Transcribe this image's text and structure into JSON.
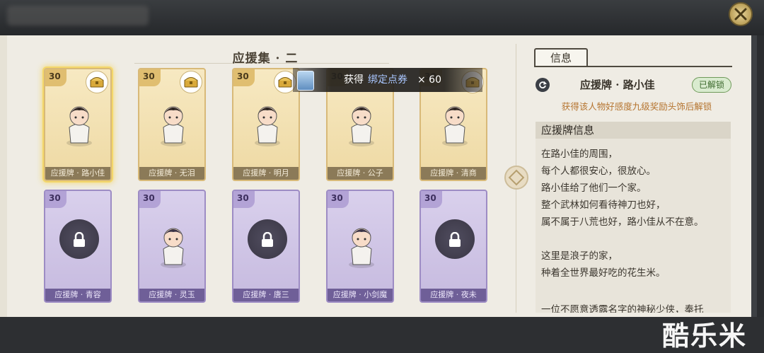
{
  "collection": {
    "title": "应援集 · 二"
  },
  "cards": [
    {
      "level": "30",
      "name": "应援牌 · 路小佳",
      "theme": "gold",
      "locked": false,
      "selected": true,
      "chest": true
    },
    {
      "level": "30",
      "name": "应援牌 · 无泪",
      "theme": "gold",
      "locked": false,
      "selected": false,
      "chest": true
    },
    {
      "level": "30",
      "name": "应援牌 · 明月",
      "theme": "gold",
      "locked": false,
      "selected": false,
      "chest": true
    },
    {
      "level": "30",
      "name": "应援牌 · 公子",
      "theme": "gold",
      "locked": false,
      "selected": false,
      "chest": false
    },
    {
      "level": "30",
      "name": "应援牌 · 清商",
      "theme": "gold",
      "locked": false,
      "selected": false,
      "chest": true
    },
    {
      "level": "30",
      "name": "应援牌 · 青容",
      "theme": "purple",
      "locked": true,
      "selected": false,
      "chest": false
    },
    {
      "level": "30",
      "name": "应援牌 · 灵玉",
      "theme": "purple",
      "locked": false,
      "selected": false,
      "chest": false
    },
    {
      "level": "30",
      "name": "应援牌 · 唐三",
      "theme": "purple",
      "locked": true,
      "selected": false,
      "chest": false
    },
    {
      "level": "30",
      "name": "应援牌 · 小剑魔",
      "theme": "purple",
      "locked": false,
      "selected": false,
      "chest": false
    },
    {
      "level": "30",
      "name": "应援牌 · 夜未",
      "theme": "purple",
      "locked": true,
      "selected": false,
      "chest": false
    }
  ],
  "toast": {
    "prefix": "获得",
    "item": "绑定点券",
    "count": "× 60"
  },
  "info_panel": {
    "tab_label": "信息",
    "title": "应援牌 · 路小佳",
    "status": "已解锁",
    "unlock_note": "获得该人物好感度九级奖励头饰后解锁",
    "section_header": "应援牌信息",
    "lines": [
      "在路小佳的周围，",
      "每个人都很安心，很放心。",
      "路小佳给了他们一个家。",
      "整个武林如何看待神刀也好，",
      "属不属于八荒也好，路小佳从不在意。",
      "",
      "这里是浪子的家，",
      "种着全世界最好吃的花生米。",
      "",
      "一位不愿意透露名字的神秘少侠，奉托"
    ]
  },
  "watermark": "酷乐米",
  "colors": {
    "gold_card": "#f2e3b5",
    "purple_card": "#d2c8e8",
    "accent": "#b5742f"
  }
}
